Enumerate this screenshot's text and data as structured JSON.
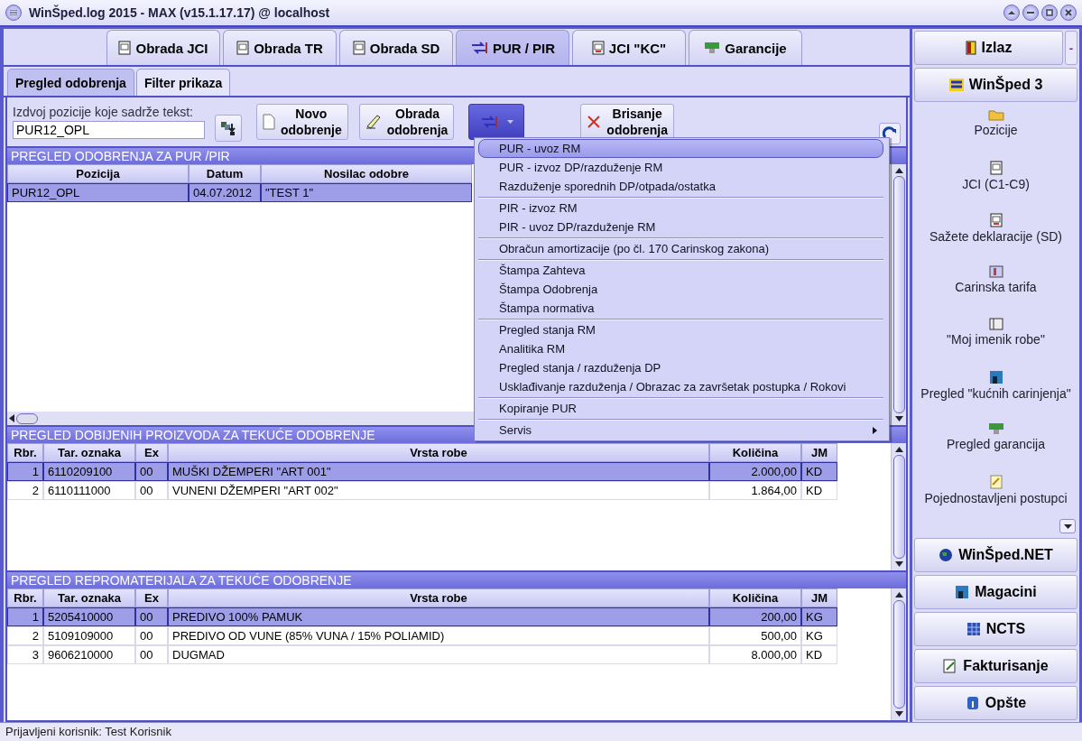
{
  "window": {
    "title": "WinŠped.log 2015 - MAX (v15.1.17.17) @ localhost"
  },
  "main_tabs": [
    {
      "label": "Obrada JCI",
      "selected": false
    },
    {
      "label": "Obrada TR",
      "selected": false
    },
    {
      "label": "Obrada SD",
      "selected": false
    },
    {
      "label": "PUR / PIR",
      "selected": true
    },
    {
      "label": "JCI \"KC\"",
      "selected": false
    },
    {
      "label": "Garancije",
      "selected": false
    }
  ],
  "sub_tabs": [
    {
      "label": "Pregled odobrenja",
      "selected": true
    },
    {
      "label": "Filter prikaza",
      "selected": false
    }
  ],
  "filter": {
    "label": "Izdvoj pozicije koje sadrže tekst:",
    "value": "PUR12_OPL"
  },
  "toolbar": {
    "new_button": [
      "Novo",
      "odobrenje"
    ],
    "edit_button": [
      "Obrada",
      "odobrenja"
    ],
    "menu_button": {
      "open": true
    },
    "delete_button": [
      "Brisanje",
      "odobrenja"
    ]
  },
  "approvals": {
    "title": "PREGLED ODOBRENJA ZA PUR /PIR",
    "columns": [
      "Pozicija",
      "Datum",
      "Nosilac odobre"
    ],
    "rows": [
      {
        "cells": [
          "PUR12_OPL",
          "04.07.2012",
          "\"TEST 1\""
        ],
        "selected": true
      }
    ]
  },
  "products": {
    "title": "PREGLED DOBIJENIH PROIZVODA ZA TEKUĆE ODOBRENJE",
    "columns": [
      "Rbr.",
      "Tar. oznaka",
      "Ex",
      "Vrsta robe",
      "Količina",
      "JM"
    ],
    "rows": [
      {
        "cells": [
          "1",
          "6110209100",
          "00",
          "MUŠKI DŽEMPERI \"ART 001\"",
          "2.000,00",
          "KD"
        ],
        "selected": true
      },
      {
        "cells": [
          "2",
          "6110111000",
          "00",
          "VUNENI DŽEMPERI \"ART 002\"",
          "1.864,00",
          "KD"
        ],
        "selected": false
      }
    ]
  },
  "materials": {
    "title": "PREGLED REPROMATERIJALA ZA TEKUĆE ODOBRENJE",
    "columns": [
      "Rbr.",
      "Tar. oznaka",
      "Ex",
      "Vrsta robe",
      "Količina",
      "JM"
    ],
    "rows": [
      {
        "cells": [
          "1",
          "5205410000",
          "00",
          "PREDIVO 100% PAMUK",
          "200,00",
          "KG"
        ],
        "selected": true
      },
      {
        "cells": [
          "2",
          "5109109000",
          "00",
          "PREDIVO OD VUNE (85% VUNA / 15% POLIAMID)",
          "500,00",
          "KG"
        ],
        "selected": false
      },
      {
        "cells": [
          "3",
          "9606210000",
          "00",
          "DUGMAD",
          "8.000,00",
          "KD"
        ],
        "selected": false
      }
    ]
  },
  "menu": {
    "groups": [
      [
        {
          "label": "PUR - uvoz RM",
          "selected": true,
          "submenu": false
        },
        {
          "label": "PUR - izvoz DP/razduženje RM",
          "selected": false,
          "submenu": false
        },
        {
          "label": "Razduženje sporednih DP/otpada/ostatka",
          "selected": false,
          "submenu": false
        }
      ],
      [
        {
          "label": "PIR - izvoz RM",
          "selected": false,
          "submenu": false
        },
        {
          "label": "PIR - uvoz DP/razduženje RM",
          "selected": false,
          "submenu": false
        }
      ],
      [
        {
          "label": "Obračun amortizacije (po čl. 170 Carinskog zakona)",
          "selected": false,
          "submenu": false
        }
      ],
      [
        {
          "label": "Štampa Zahteva",
          "selected": false,
          "submenu": false
        },
        {
          "label": "Štampa Odobrenja",
          "selected": false,
          "submenu": false
        },
        {
          "label": "Štampa normativa",
          "selected": false,
          "submenu": false
        }
      ],
      [
        {
          "label": "Pregled stanja RM",
          "selected": false,
          "submenu": false
        },
        {
          "label": "Analitika RM",
          "selected": false,
          "submenu": false
        },
        {
          "label": "Pregled stanja / razduženja DP",
          "selected": false,
          "submenu": false
        },
        {
          "label": "Usklađivanje razduženja / Obrazac za završetak postupka / Rokovi",
          "selected": false,
          "submenu": false
        }
      ],
      [
        {
          "label": "Kopiranje PUR",
          "selected": false,
          "submenu": false
        }
      ],
      [
        {
          "label": "Servis",
          "selected": false,
          "submenu": true
        }
      ]
    ]
  },
  "sidebar": {
    "exit_button": "Izlaz",
    "minimize_button": "-",
    "header": "WinŠped 3",
    "items": [
      "Pozicije",
      "JCI (C1-C9)",
      "Sažete deklaracije (SD)",
      "Carinska tarifa",
      "\"Moj imenik robe\"",
      "Pregled \"kućnih carinjenja\"",
      "Pregled garancija",
      "Pojednostavljeni postupci"
    ],
    "sections": [
      "WinŠped.NET",
      "Magacini",
      "NCTS",
      "Fakturisanje",
      "Opšte"
    ]
  },
  "status_bar": "Prijavljeni korisnik: Test Korisnik"
}
